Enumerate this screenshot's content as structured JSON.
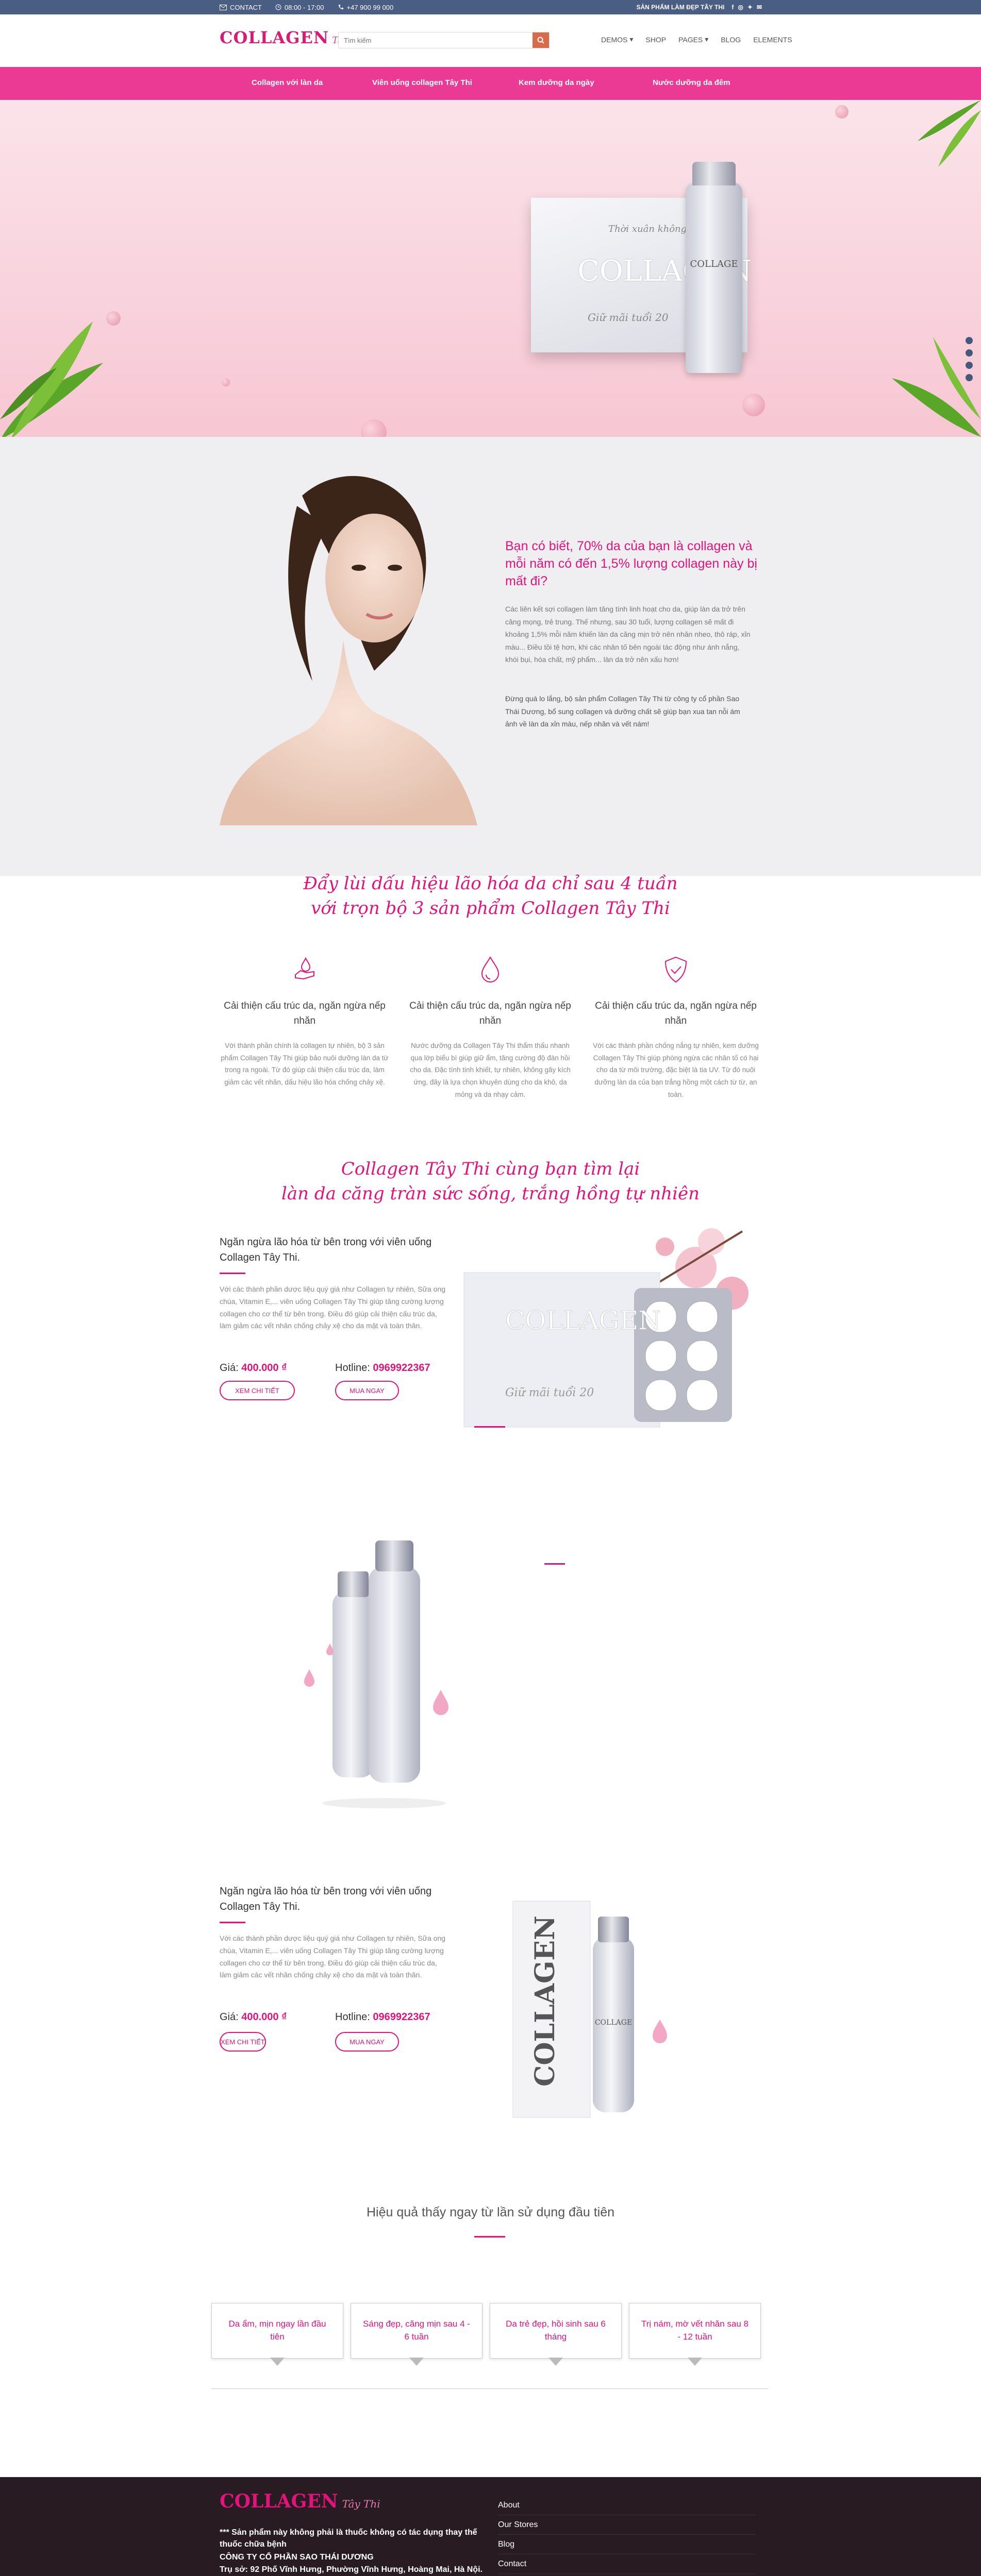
{
  "topbar": {
    "contact": "CONTACT",
    "hours": "08:00 - 17:00",
    "phone": "+47 900 99 000",
    "tagline": "SẢN PHẨM LÀM ĐẸP TÂY THI",
    "social": [
      "facebook-icon",
      "instagram-icon",
      "twitter-icon",
      "email-icon"
    ]
  },
  "header": {
    "logo_main": "COLLAGEN",
    "logo_script": "Tây Thi",
    "search_placeholder": "Tìm kiếm",
    "nav": [
      "DEMOS",
      "SHOP",
      "PAGES",
      "BLOG",
      "ELEMENTS"
    ]
  },
  "menu": [
    "Collagen với làn da",
    "Viên uống collagen Tây Thi",
    "Kem dưỡng da ngày",
    "Nước dưỡng da đêm"
  ],
  "hero": {
    "box_sub1": "Thời xuân không tuổi",
    "box_brand": "COLLAGEN",
    "box_sub2": "Giữ mãi tuổi 20",
    "bottle_text": "COLLAGE"
  },
  "about": {
    "title": "Bạn có biết, 70% da của bạn là collagen và mỗi năm có đến 1,5% lượng collagen này bị mất đi?",
    "para1": "Các liên kết sợi collagen làm tăng tính linh hoạt cho da, giúp làn da trở trên căng mọng, trẻ trung. Thế nhưng, sau 30 tuổi, lượng collagen sẽ mất đi khoảng 1,5% mỗi năm khiến làn da căng mịn trở nên nhăn nheo, thô ráp, xỉn màu... Điều tồi tệ hơn, khi các nhân tố bên ngoài tác động như ánh nắng, khói bụi, hóa chất, mỹ phẩm... làn da trở nên xấu hơn!",
    "para2": "Đừng quá lo lắng, bộ sản phẩm Collagen Tây Thi từ công ty cổ phần Sao Thái Dương, bổ sung collagen và dưỡng chất sẽ giúp bạn xua tan nỗi ám ảnh về làn da xỉn màu, nếp nhăn và vết nám!"
  },
  "benefits": {
    "title_line1": "Đẩy lùi dấu hiệu lão hóa da chỉ sau 4 tuần",
    "title_line2": "với trọn bộ 3 sản phẩm Collagen Tây Thi",
    "items": [
      {
        "icon": "hand-drop-icon",
        "title": "Cải thiện cấu trúc da, ngăn ngừa nếp nhăn",
        "text": "Với thành phần chính là collagen tự nhiên, bộ 3 sản phẩm Collagen Tây Thi giúp bảo nuôi dưỡng làn da từ trong ra ngoài. Từ đó giúp cải thiện cấu trúc da, làm giảm các vết nhăn, dấu hiệu lão hóa chống chảy xệ."
      },
      {
        "icon": "droplet-icon",
        "title": "Cải thiện cấu trúc da, ngăn ngừa nếp nhăn",
        "text": "Nước dưỡng da Collagen Tây Thi thẩm thấu nhanh qua lớp biểu bì giúp giữ ẩm, tăng cường độ đàn hồi cho da. Đặc tính tinh khiết, tự nhiên, không gây kích ứng, đây là lựa chọn khuyên dùng cho da khô, da mỏng và da nhạy cảm."
      },
      {
        "icon": "shield-check-icon",
        "title": "Cải thiện cấu trúc da, ngăn ngừa nếp nhăn",
        "text": "Với các thành phần chống nắng tự nhiên, kem dưỡng Collagen Tây Thi giúp phòng ngừa các nhân tố có hại cho da từ môi trường, đặc biệt là tia UV. Từ đó nuôi dưỡng làn da của bạn trắng hồng một cách từ từ, an toàn."
      }
    ]
  },
  "products_section": {
    "title_line1": "Collagen Tây Thi cùng bạn tìm lại",
    "title_line2": "làn da căng tràn sức sống, trắng hồng tự nhiên"
  },
  "product1": {
    "title": "Ngăn ngừa lão hóa từ bên trong với viên uống Collagen Tây Thi.",
    "desc": "Với các thành phần dược liệu quý giá như Collagen tự nhiên, Sữa ong chúa, Vitamin E,... viên uống Collagen Tây Thi giúp tăng cường lượng collagen cho cơ thể từ bên trong. Điều đó giúp cải thiện cấu trúc da, làm giảm các vết nhăn chống chảy xệ cho da mặt và toàn thân.",
    "price_label": "Giá:",
    "price": "400.000 ₫",
    "hotline_label": "Hotline:",
    "hotline": "0969922367",
    "detail_btn": "XEM CHI TIẾT",
    "buy_btn": "MUA NGAY",
    "box_brand": "COLLAGEN",
    "box_sub": "Giữ mãi tuổi 20"
  },
  "product2": {
    "title": "Ngăn ngừa lão hóa từ bên trong với viên uống Collagen Tây Thi.",
    "desc": "Với các thành phần dược liệu quý giá như Collagen tự nhiên, Sữa ong chúa, Vitamin E,... viên uống Collagen Tây Thi giúp tăng cường lượng collagen cho cơ thể từ bên trong. Điều đó giúp cải thiện cấu trúc da, làm giảm các vết nhăn chống chảy xệ cho da mặt và toàn thân.",
    "price_label": "Giá:",
    "price": "400.000 ₫",
    "hotline_label": "Hotline:",
    "hotline": "0969922367",
    "detail_btn": "XEM CHI TIẾT",
    "buy_btn": "MUA NGAY",
    "box_brand": "COLLAGEN",
    "bottle_text": "COLLAGE"
  },
  "timeline": {
    "title": "Hiệu quả thấy ngay từ lần sử dụng đầu tiên",
    "steps": [
      "Da ẩm, mịn ngay lần đầu tiên",
      "Sáng đẹp, căng mịn sau 4 - 6 tuần",
      "Da trẻ đẹp, hồi sinh sau 6 tháng",
      "Trị nám, mờ vết nhăn sau 8 - 12 tuần"
    ]
  },
  "footer": {
    "logo_main": "COLLAGEN",
    "logo_script": "Tây Thi",
    "note": "*** Sản phẩm này không phải là thuốc không có tác dụng thay thế thuốc chữa bệnh",
    "company": "CÔNG TY CỔ PHẦN SAO THÁI DƯƠNG",
    "address": "Trụ sở: 92 Phố Vĩnh Hưng, Phường Vĩnh Hưng, Hoàng Mai, Hà Nội.",
    "links": [
      "About",
      "Our Stores",
      "Blog",
      "Contact"
    ]
  },
  "colors": {
    "accent": "#e2137a",
    "menu": "#ea3a93",
    "topbar": "#4a5d82",
    "footer": "#281c22"
  }
}
